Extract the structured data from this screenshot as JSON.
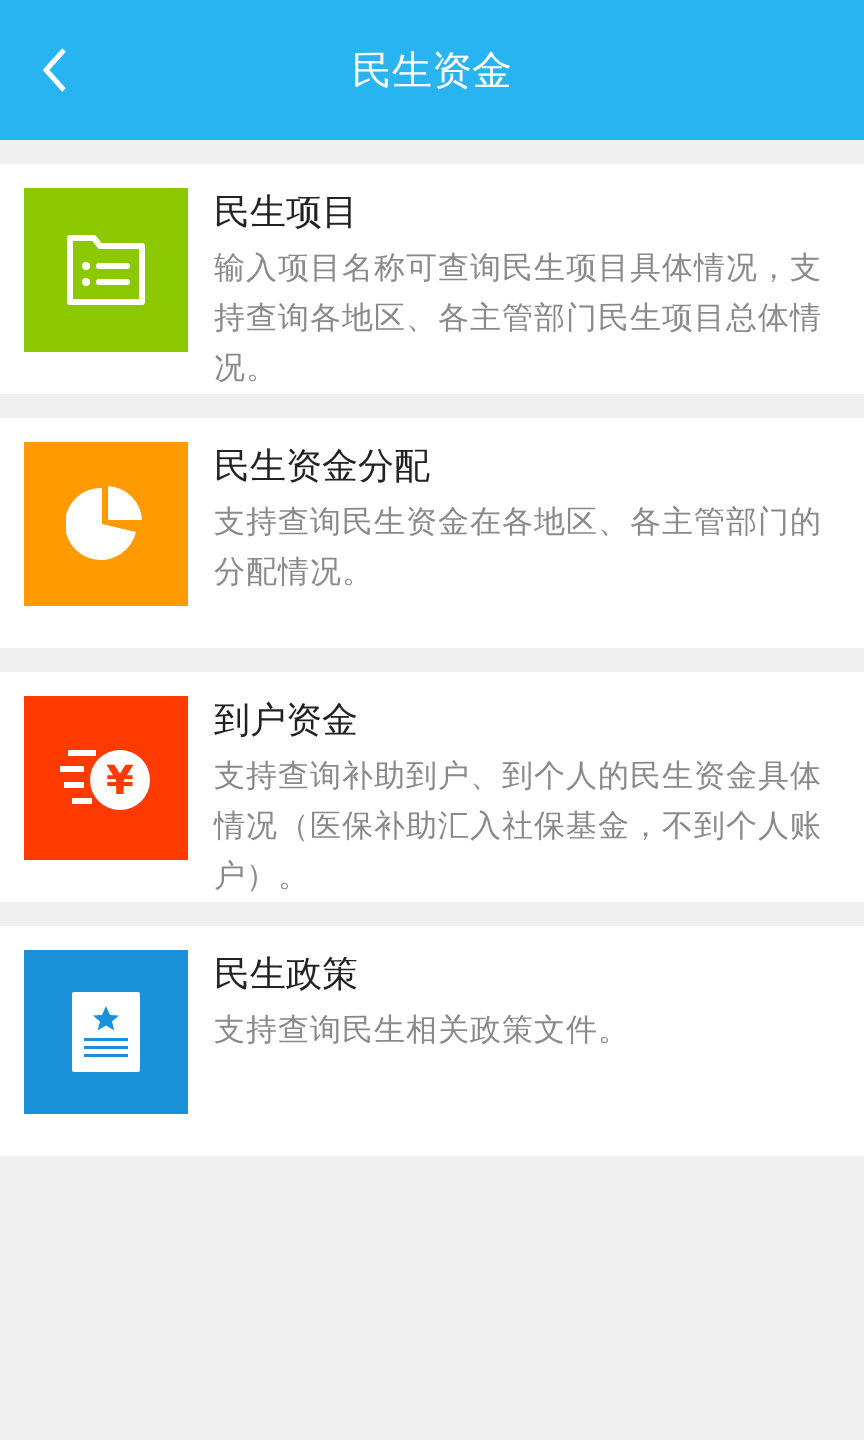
{
  "header": {
    "title": "民生资金"
  },
  "items": [
    {
      "kind": "folder",
      "color": "#8cc800",
      "title": "民生项目",
      "description": "输入项目名称可查询民生项目具体情况，支持查询各地区、各主管部门民生项目总体情况。"
    },
    {
      "kind": "pie",
      "color": "#ff9a00",
      "title": "民生资金分配",
      "description": "支持查询民生资金在各地区、各主管部门的分配情况。"
    },
    {
      "kind": "coin",
      "color": "#ff3a00",
      "title": "到户资金",
      "description": "支持查询补助到户、到个人的民生资金具体情况（医保补助汇入社保基金，不到个人账户）。",
      "symbol": "¥"
    },
    {
      "kind": "document",
      "color": "#1a90d9",
      "title": "民生政策",
      "description": "支持查询民生相关政策文件。"
    }
  ]
}
